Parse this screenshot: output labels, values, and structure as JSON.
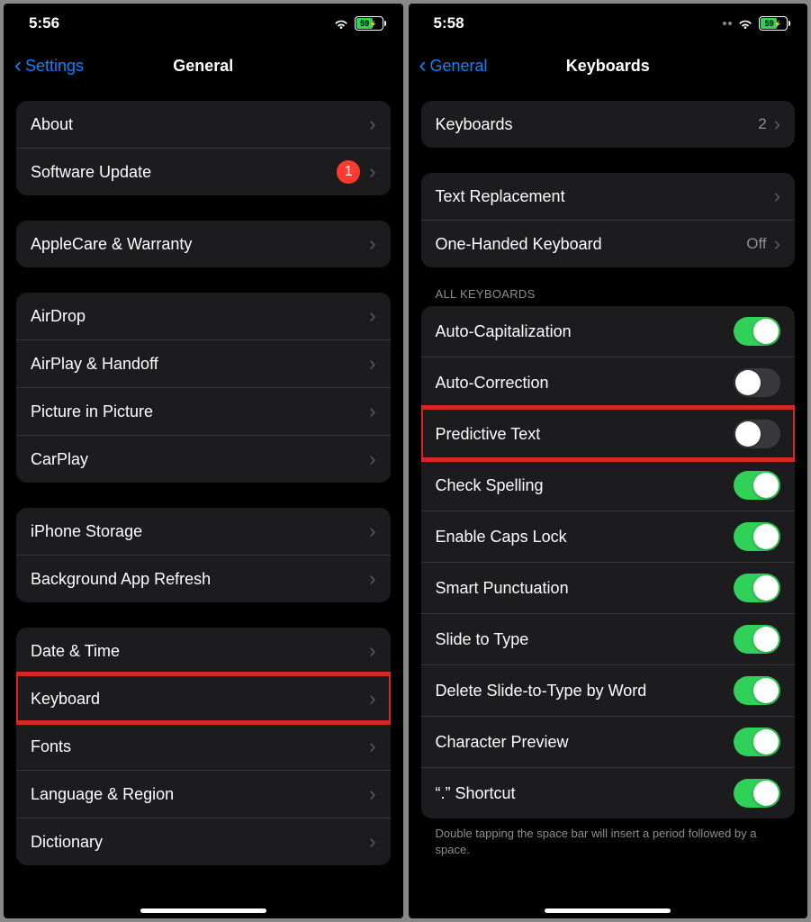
{
  "left": {
    "time": "5:56",
    "battery": "59",
    "back_label": "Settings",
    "title": "General",
    "groups": [
      [
        {
          "label": "About",
          "badge": null,
          "hl": false
        },
        {
          "label": "Software Update",
          "badge": "1",
          "hl": false
        }
      ],
      [
        {
          "label": "AppleCare & Warranty",
          "badge": null,
          "hl": false
        }
      ],
      [
        {
          "label": "AirDrop",
          "badge": null,
          "hl": false
        },
        {
          "label": "AirPlay & Handoff",
          "badge": null,
          "hl": false
        },
        {
          "label": "Picture in Picture",
          "badge": null,
          "hl": false
        },
        {
          "label": "CarPlay",
          "badge": null,
          "hl": false
        }
      ],
      [
        {
          "label": "iPhone Storage",
          "badge": null,
          "hl": false
        },
        {
          "label": "Background App Refresh",
          "badge": null,
          "hl": false
        }
      ],
      [
        {
          "label": "Date & Time",
          "badge": null,
          "hl": false
        },
        {
          "label": "Keyboard",
          "badge": null,
          "hl": true
        },
        {
          "label": "Fonts",
          "badge": null,
          "hl": false
        },
        {
          "label": "Language & Region",
          "badge": null,
          "hl": false
        },
        {
          "label": "Dictionary",
          "badge": null,
          "hl": false
        }
      ]
    ]
  },
  "right": {
    "time": "5:58",
    "battery": "59",
    "back_label": "General",
    "title": "Keyboards",
    "show_dots": true,
    "keyboards_row": {
      "label": "Keyboards",
      "value": "2"
    },
    "text_replacement": "Text Replacement",
    "one_handed": {
      "label": "One-Handed Keyboard",
      "value": "Off"
    },
    "section_header": "ALL KEYBOARDS",
    "toggles": [
      {
        "label": "Auto-Capitalization",
        "on": true,
        "hl": false
      },
      {
        "label": "Auto-Correction",
        "on": false,
        "hl": false
      },
      {
        "label": "Predictive Text",
        "on": false,
        "hl": true
      },
      {
        "label": "Check Spelling",
        "on": true,
        "hl": false
      },
      {
        "label": "Enable Caps Lock",
        "on": true,
        "hl": false
      },
      {
        "label": "Smart Punctuation",
        "on": true,
        "hl": false
      },
      {
        "label": "Slide to Type",
        "on": true,
        "hl": false
      },
      {
        "label": "Delete Slide-to-Type by Word",
        "on": true,
        "hl": false
      },
      {
        "label": "Character Preview",
        "on": true,
        "hl": false
      },
      {
        "label": "“.” Shortcut",
        "on": true,
        "hl": false
      }
    ],
    "footer": "Double tapping the space bar will insert a period followed by a space."
  }
}
